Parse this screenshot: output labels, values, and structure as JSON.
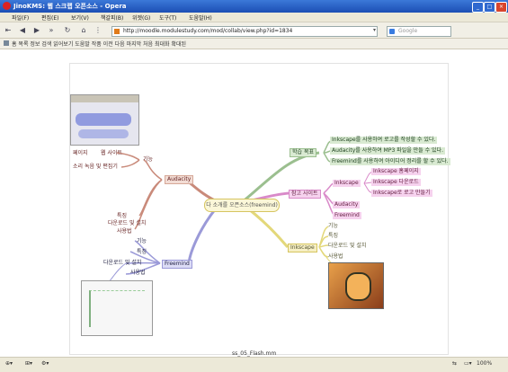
{
  "window": {
    "title": "JinoKMS: 웹 스크랩 오픈소스 - Opera"
  },
  "menu": [
    "파일(F)",
    "편집(E)",
    "보기(V)",
    "책갈피(B)",
    "위젯(G)",
    "도구(T)",
    "도움말(H)"
  ],
  "address": {
    "url": "http://moodle.modulestudy.com/mod/collab/view.php?id=1834",
    "search_placeholder": "Google"
  },
  "bookmark_bar": "홈 목록 정보 검색 읽어보기 도움말 작품 이전 다음 마지막 처음 최대화 확대된",
  "mindmap": {
    "root": "다 소개를 오픈소스(freemind)",
    "left": {
      "audacity": {
        "label": "Audacity",
        "items": [
          "기능",
          "소리 녹음 및 편집기"
        ],
        "site_label": "페이지",
        "site_value": "웹 사이트"
      },
      "freemind": {
        "label": "Freemind",
        "items": [
          "특징",
          "다운로드 및 설치",
          "사용법"
        ]
      },
      "freemind_sub": [
        "기능",
        "특징",
        "다운로드 및 설치",
        "사용법"
      ]
    },
    "right": {
      "goal": {
        "label": "학습 목표",
        "items": [
          "Inkscape를 사용하여 로고를 작성할 수 있다.",
          "Audacity를 사용하여 MP3 파일을 만들 수 있다.",
          "Freemind를 사용하여 아이디어 정리를 할 수 있다."
        ]
      },
      "links": {
        "label": "참고 사이트",
        "inkscape": "Inkscape",
        "audacity": "Audacity",
        "freemind": "Freemind",
        "inkscape_items": [
          "Inkscape 홈페이지",
          "Inkscape 다운로드",
          "Inkscape로 로고 만들기"
        ]
      },
      "inkscape": {
        "label": "Inkscape",
        "items": [
          "기능",
          "특징",
          "다운로드 및 설치",
          "사용법"
        ]
      }
    },
    "filename": "ss_05_Flash.mm"
  },
  "status": {
    "zoom": "100%"
  },
  "colors": {
    "title": "#2a5fc7",
    "audacity": "#c98a7a",
    "freemind": "#9b9ad8",
    "goal": "#9bbf8f",
    "links": "#d98ac9",
    "inkscape": "#d6c560"
  }
}
